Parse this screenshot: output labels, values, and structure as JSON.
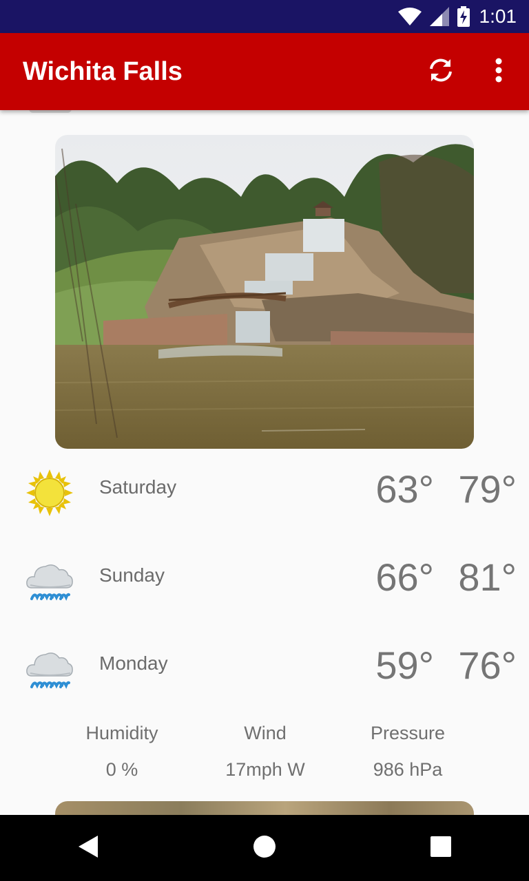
{
  "status_bar": {
    "time": "1:01",
    "icons": [
      "wifi-icon",
      "signal-icon",
      "battery-charging-icon"
    ]
  },
  "app_bar": {
    "title": "Wichita Falls",
    "actions": [
      "refresh-icon",
      "overflow-menu-icon"
    ]
  },
  "colors": {
    "app_bar": "#c40000",
    "status_bar": "#1a1464",
    "text_muted": "#757575"
  },
  "hero": {
    "icon": "waterfall-photo"
  },
  "forecast": [
    {
      "day": "Saturday",
      "low": "63°",
      "high": "79°",
      "icon": "sunny-icon"
    },
    {
      "day": "Sunday",
      "low": "66°",
      "high": "81°",
      "icon": "rain-icon"
    },
    {
      "day": "Monday",
      "low": "59°",
      "high": "76°",
      "icon": "rain-icon"
    }
  ],
  "details": {
    "humidity_label": "Humidity",
    "humidity_value": "0 %",
    "wind_label": "Wind",
    "wind_value": "17mph W",
    "pressure_label": "Pressure",
    "pressure_value": "986 hPa"
  },
  "nav_bar": {
    "buttons": [
      "back-icon",
      "home-icon",
      "recents-icon"
    ]
  }
}
